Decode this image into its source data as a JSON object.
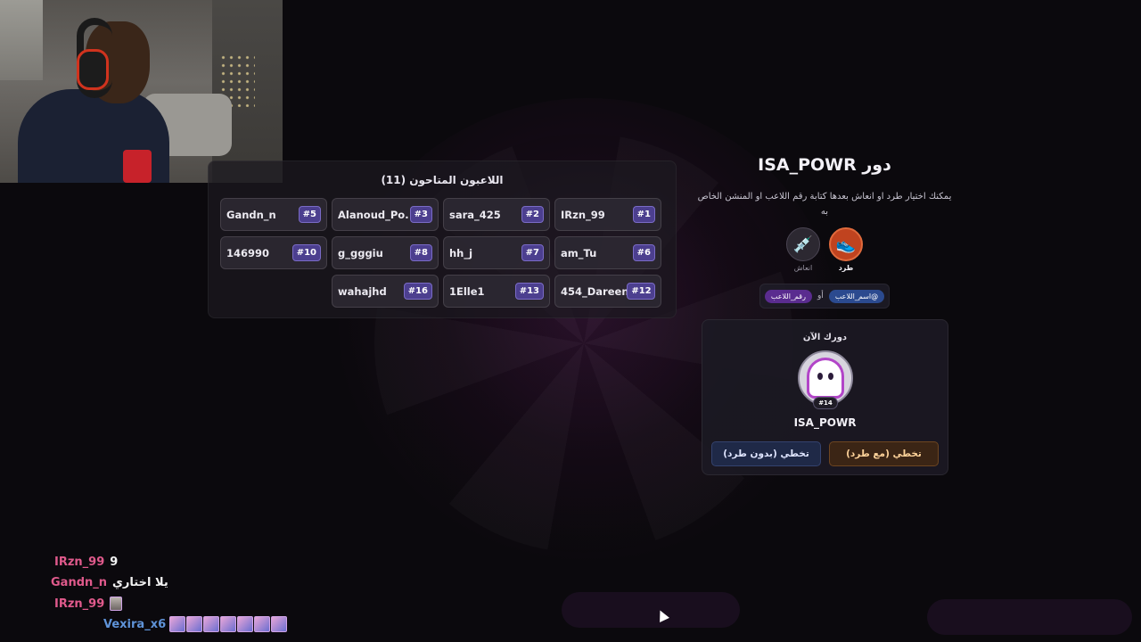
{
  "players_panel": {
    "title": "اللاعبون المتاحون (11)",
    "players": [
      {
        "name": "IRzn_99",
        "number": "#1"
      },
      {
        "name": "sara_425",
        "number": "#2"
      },
      {
        "name": "Alanoud_Po...",
        "number": "#3"
      },
      {
        "name": "Gandn_n",
        "number": "#5"
      },
      {
        "name": "am_Tu",
        "number": "#6"
      },
      {
        "name": "hh_j",
        "number": "#7"
      },
      {
        "name": "g_gggiu",
        "number": "#8"
      },
      {
        "name": "146990",
        "number": "#10"
      },
      {
        "name": "454_Dareen",
        "number": "#12"
      },
      {
        "name": "1Elle1",
        "number": "#13"
      },
      {
        "name": "wahajhd",
        "number": "#16"
      }
    ]
  },
  "turn": {
    "title": "دور ISA_POWR",
    "description": "يمكنك اختيار طرد او انعاش بعدها كتابة رقم اللاعب او المنشن الخاص به",
    "actions": [
      {
        "label": "طرد",
        "icon": "kick-shoe-icon",
        "color": "#c0431f"
      },
      {
        "label": "انعاش",
        "icon": "syringe-icon",
        "color": "#3a3440"
      }
    ],
    "hint": {
      "chip_name": "@اسم_اللاعب",
      "or": "أو",
      "chip_number": "رقم_اللاعب"
    }
  },
  "now_card": {
    "title": "دورك الآن",
    "avatar_number": "#14",
    "player_name": "ISA_POWR",
    "skip_with_kick": "تخطي (مع طرد)",
    "skip_without_kick": "تخطي (بدون طرد)"
  },
  "chat": [
    {
      "user": "IRzn_99",
      "message": "9"
    },
    {
      "user": "Gandn_n",
      "message": "يلا اختاري"
    },
    {
      "user": "IRzn_99",
      "message": ""
    },
    {
      "user": "Vexira_x6",
      "message": ""
    }
  ],
  "colors": {
    "accent_kick": "#c0431f",
    "player_badge": "#4c3f8f",
    "chat_user_pink": "#e05a8c",
    "chat_user_blue": "#5f93d8"
  }
}
